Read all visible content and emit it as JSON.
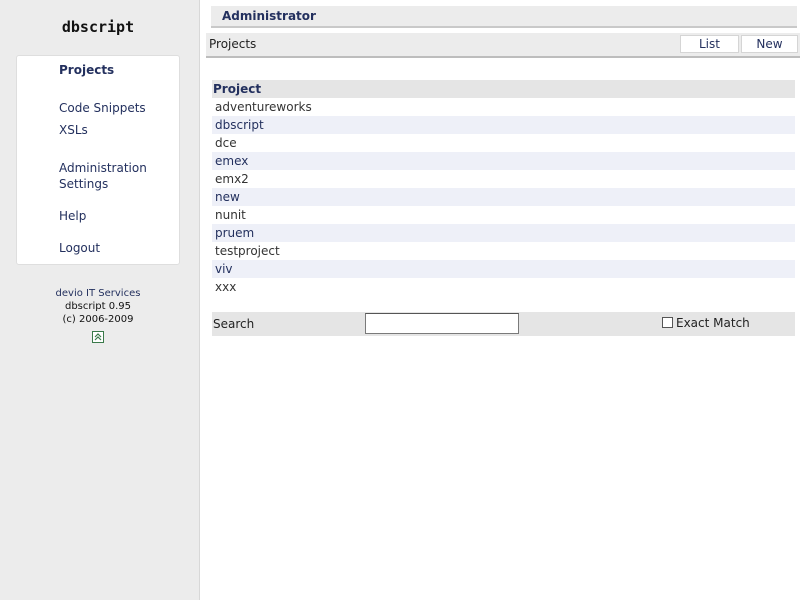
{
  "logo": "dbscript",
  "menu": {
    "items": [
      {
        "label": "Projects",
        "active": true
      },
      {
        "label": "Code Snippets"
      },
      {
        "label": "XSLs"
      },
      {
        "label": "Administration"
      },
      {
        "label": "Settings"
      },
      {
        "label": "Help"
      },
      {
        "label": "Logout"
      }
    ]
  },
  "footer": {
    "company": "devio IT Services",
    "version": "dbscript 0.95",
    "copyright": "(c) 2006-2009",
    "icon": "scroll-top-icon"
  },
  "header": {
    "title": "Administrator"
  },
  "toolbar": {
    "breadcrumb": "Projects",
    "list_label": "List",
    "new_label": "New"
  },
  "table": {
    "header": "Project",
    "rows": [
      "adventureworks",
      "dbscript",
      "dce",
      "emex",
      "emx2",
      "new",
      "nunit",
      "pruem",
      "testproject",
      "viv",
      "xxx"
    ]
  },
  "search": {
    "label": "Search",
    "value": "",
    "exact_match_label": "Exact Match",
    "exact_match_checked": false
  },
  "colors": {
    "accent": "#23305e",
    "panel": "#ececec",
    "row_alt": "#eef0f8"
  }
}
